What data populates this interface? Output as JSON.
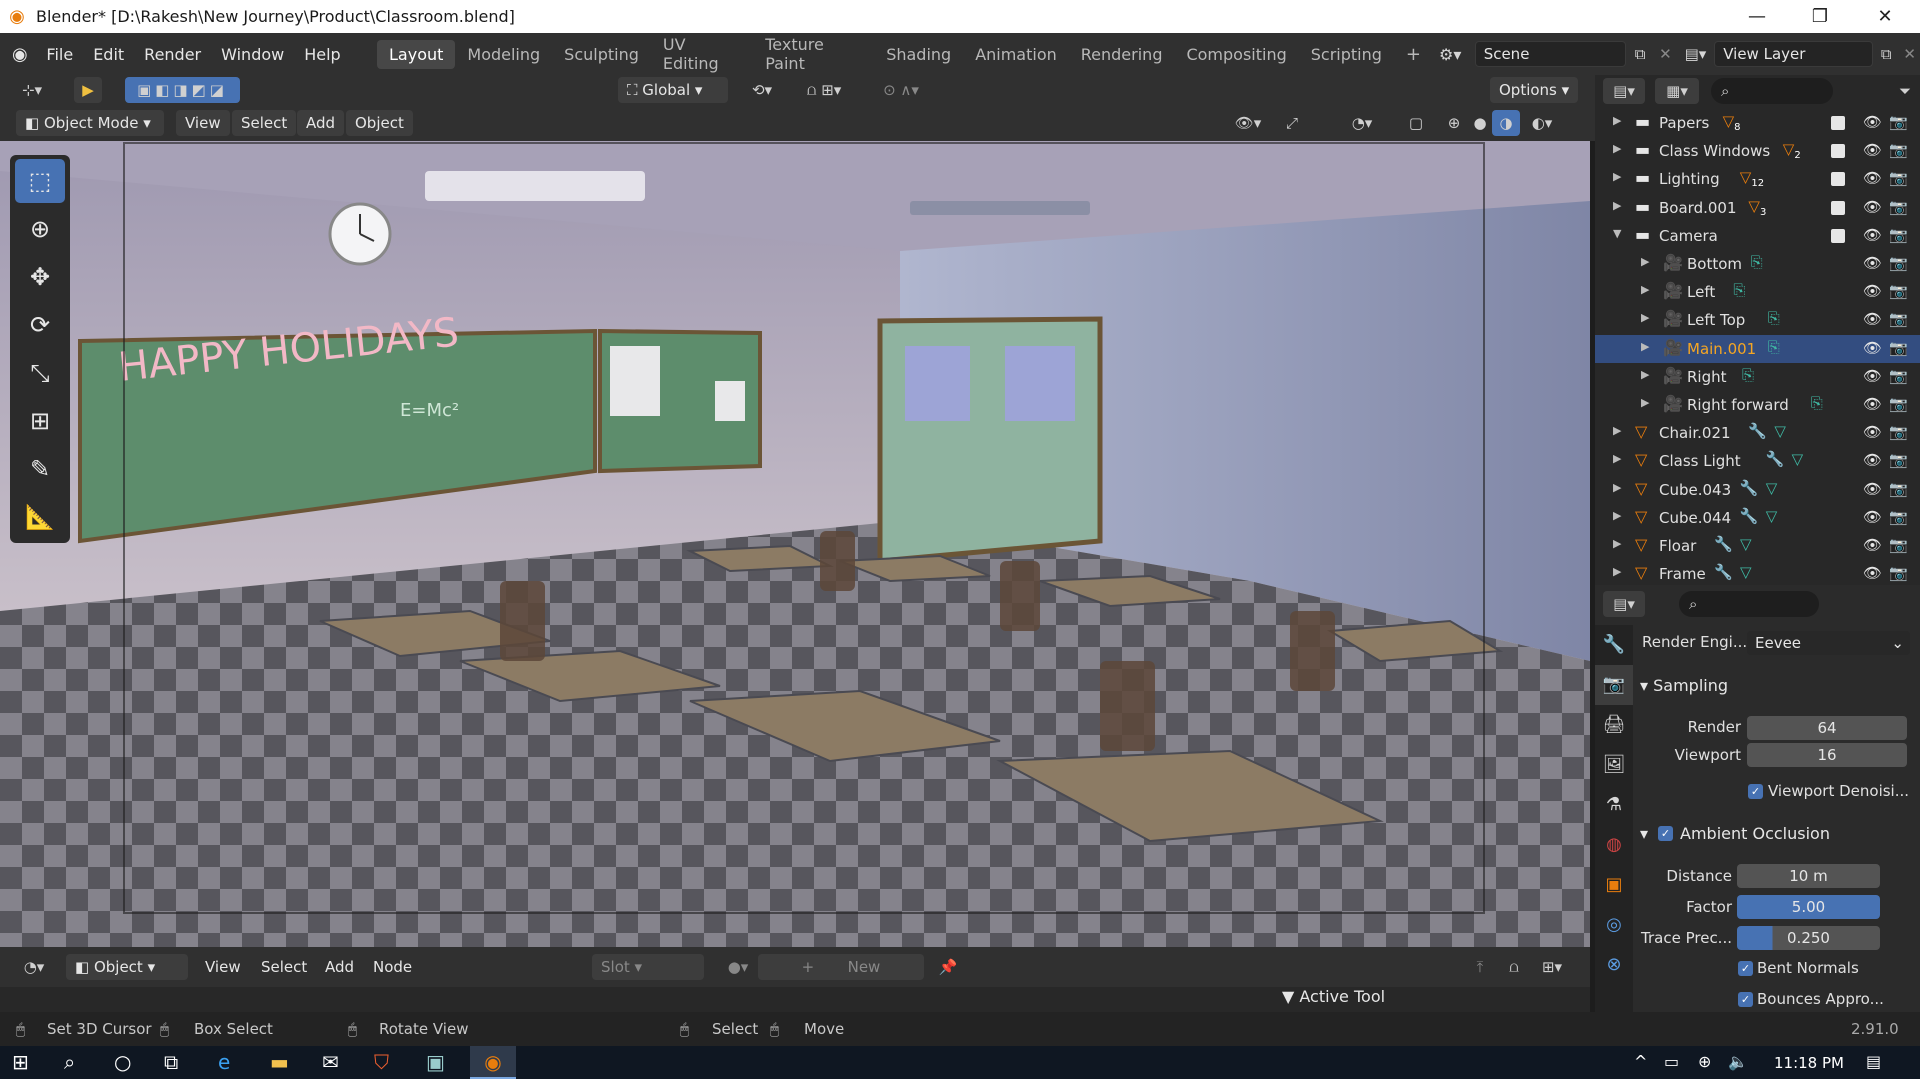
{
  "window": {
    "title": "Blender* [D:\\Rakesh\\New Journey\\Product\\Classroom.blend]",
    "minimize": "—",
    "maximize": "❐",
    "close": "✕"
  },
  "menu": [
    "File",
    "Edit",
    "Render",
    "Window",
    "Help"
  ],
  "workspaces": [
    "Layout",
    "Modeling",
    "Sculpting",
    "UV Editing",
    "Texture Paint",
    "Shading",
    "Animation",
    "Rendering",
    "Compositing",
    "Scripting"
  ],
  "scene": {
    "name": "Scene",
    "view_layer": "View Layer"
  },
  "toolbar": {
    "transform_orientation": "Global",
    "options": "Options"
  },
  "viewport_header": {
    "mode": "Object Mode",
    "view": "View",
    "select": "Select",
    "add": "Add",
    "object": "Object"
  },
  "scene_text": {
    "board": "HAPPY HOLIDAYS",
    "formula": "E=Mc²"
  },
  "outliner": {
    "items": [
      {
        "label": "Papers",
        "badge": "8",
        "kind": "collection"
      },
      {
        "label": "Class Windows",
        "badge": "2",
        "kind": "collection"
      },
      {
        "label": "Lighting",
        "badge": "12",
        "kind": "collection"
      },
      {
        "label": "Board.001",
        "badge": "3",
        "kind": "collection"
      },
      {
        "label": "Camera",
        "badge": "",
        "kind": "collection"
      },
      {
        "label": "Bottom",
        "kind": "camera"
      },
      {
        "label": "Left",
        "kind": "camera"
      },
      {
        "label": "Left Top",
        "kind": "camera"
      },
      {
        "label": "Main.001",
        "kind": "camera"
      },
      {
        "label": "Right",
        "kind": "camera"
      },
      {
        "label": "Right forward",
        "kind": "camera"
      },
      {
        "label": "Chair.021",
        "kind": "mesh"
      },
      {
        "label": "Class Light",
        "kind": "mesh"
      },
      {
        "label": "Cube.043",
        "kind": "mesh"
      },
      {
        "label": "Cube.044",
        "kind": "mesh"
      },
      {
        "label": "Floar",
        "kind": "mesh"
      },
      {
        "label": "Frame",
        "kind": "mesh"
      }
    ]
  },
  "properties": {
    "render_engine_label": "Render Engi...",
    "render_engine": "Eevee",
    "sampling_title": "Sampling",
    "render_label": "Render",
    "render_value": "64",
    "viewport_label": "Viewport",
    "viewport_value": "16",
    "viewport_denoise": "Viewport Denoisi...",
    "ao_title": "Ambient Occlusion",
    "distance_label": "Distance",
    "distance_value": "10 m",
    "factor_label": "Factor",
    "factor_value": "5.00",
    "trace_label": "Trace Prec...",
    "trace_value": "0.250",
    "bent_normals": "Bent Normals",
    "bounces": "Bounces Appro..."
  },
  "shader_header": {
    "object": "Object",
    "view": "View",
    "select": "Select",
    "add": "Add",
    "node": "Node",
    "slot": "Slot",
    "new": "New"
  },
  "active_tool": "Active Tool",
  "status": {
    "set_cursor": "Set 3D Cursor",
    "box_select": "Box Select",
    "rotate_view": "Rotate View",
    "select": "Select",
    "move": "Move",
    "version": "2.91.0"
  },
  "taskbar": {
    "time": "11:18 PM"
  },
  "colors": {
    "accent": "#4772b3",
    "orange": "#e87d0d",
    "camera_green": "#3fb8a3",
    "selection": "#334d80"
  }
}
